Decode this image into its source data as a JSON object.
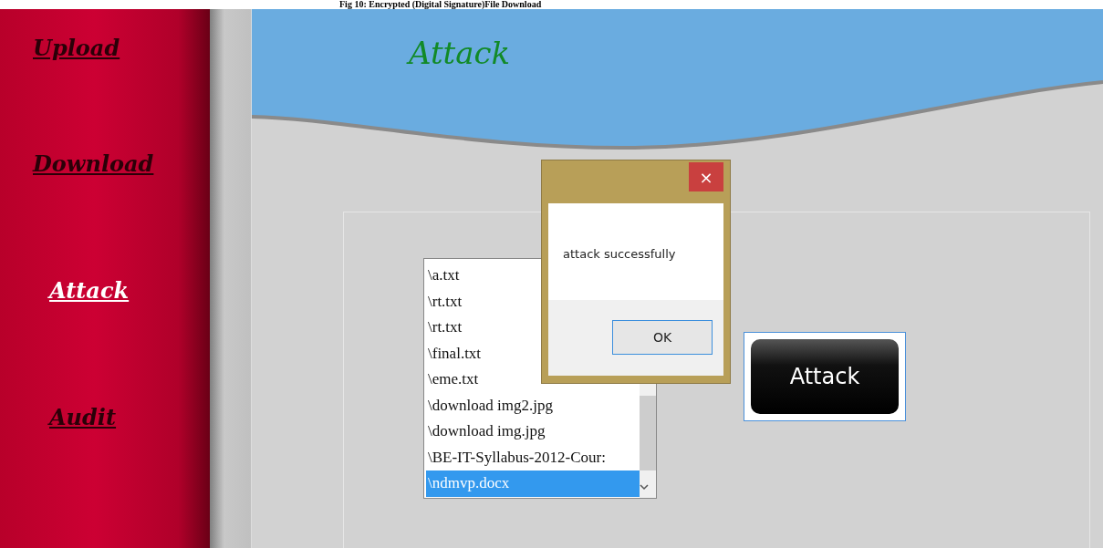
{
  "caption": "Fig 10: Encrypted (Digital Signature)File Download",
  "sidebar": {
    "items": [
      {
        "label": "Upload",
        "selected": false
      },
      {
        "label": "Download",
        "selected": false
      },
      {
        "label": "Attack",
        "selected": true
      },
      {
        "label": "Audit",
        "selected": false
      }
    ]
  },
  "header": {
    "title": "Attack"
  },
  "file_list": {
    "items": [
      {
        "label": "\\a.txt",
        "selected": false
      },
      {
        "label": "\\rt.txt",
        "selected": false
      },
      {
        "label": "\\rt.txt",
        "selected": false
      },
      {
        "label": "\\final.txt",
        "selected": false
      },
      {
        "label": "\\eme.txt",
        "selected": false
      },
      {
        "label": "\\download img2.jpg",
        "selected": false
      },
      {
        "label": "\\download img.jpg",
        "selected": false
      },
      {
        "label": "\\BE-IT-Syllabus-2012-Cour:",
        "selected": false
      },
      {
        "label": "\\ndmvp.docx",
        "selected": true
      }
    ]
  },
  "attack_button": {
    "label": "Attack"
  },
  "dialog": {
    "message": "attack successfully",
    "close": "×",
    "ok": "OK"
  }
}
